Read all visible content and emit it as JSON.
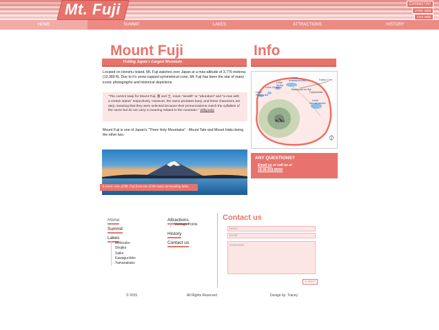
{
  "header": {
    "logo": "Mt. Fuji",
    "contact_button": "Contact Us!",
    "html_valid": "HTML Valid",
    "css_valid": "CSS Valid"
  },
  "nav": [
    "HOME",
    "SUMMIT",
    "LAKES",
    "ATTRACTIONS",
    "HISTORY"
  ],
  "main": {
    "title": "Mount Fuji",
    "subtitle": "Visiting Japan's Largest Mountain",
    "intro": "Located on Honshu Island, Mt. Fuji watches over Japan at a max-altitude of 3,776 meterss (12,389 ft). Due to it's snow-capped symmetrical cone, Mt. Fuji has been the star of many iconic photographs and historical depictions.",
    "quote": "\"The current kanji for Mount Fuji, 富 and 士, mean \"wealth\" or \"abundant\" and \"a man with a certain status\" respectively. However, the name predates kanji, and these characters are ateji, meaning that they were selected because their pronunciations match the syllables of the name but do not carry a meaning related to the mountain.\"",
    "quote_source": "Wikipedia",
    "holy": "Mount Fuji is one of Japan's \"Three Holy Mountains\" - Mount Tate and Mount Haku being the other two.",
    "caption": "A scenic view of Mt. Fuji from one of the many surrounding lakes"
  },
  "info": {
    "title": "Info",
    "map_labels": [
      "Lake Kawaguchiko",
      "Lake Saiko",
      "Lake Shojiko",
      "Lake Motosuko",
      "Lake Yamanakako",
      "Kawaguchi-ko Sta.",
      "Fujiyoshida",
      "Mt. Fuji",
      "Fujikyu Line"
    ],
    "questions_head": "ANY QUESTIONS?",
    "questions_link": "Email us",
    "questions_rest": " or call us at",
    "phone": "18.06.555.5555!"
  },
  "footer_nav": {
    "home": "Home",
    "summit": "Summit",
    "lakes": "Lakes",
    "lake_items": [
      "Motosuko",
      "Shojiko",
      "Saiko",
      "Kawaguchiko",
      "Yamanakako"
    ],
    "attractions": "Attractions",
    "attraction_items": [
      "Vantage Points"
    ],
    "history": "History",
    "contact": "Contact us"
  },
  "contact_form": {
    "title": "Contact us",
    "name_placeholder": "Name:",
    "email_placeholder": "Email:",
    "comments_placeholder": "Comments:",
    "submit": "SUBMIT"
  },
  "footer": {
    "copyright": "© 2015",
    "rights": "All Rights Reserved",
    "design": "Design by: Tracey"
  },
  "colors": {
    "accent": "#e8736c",
    "light": "#fbe6e5"
  }
}
